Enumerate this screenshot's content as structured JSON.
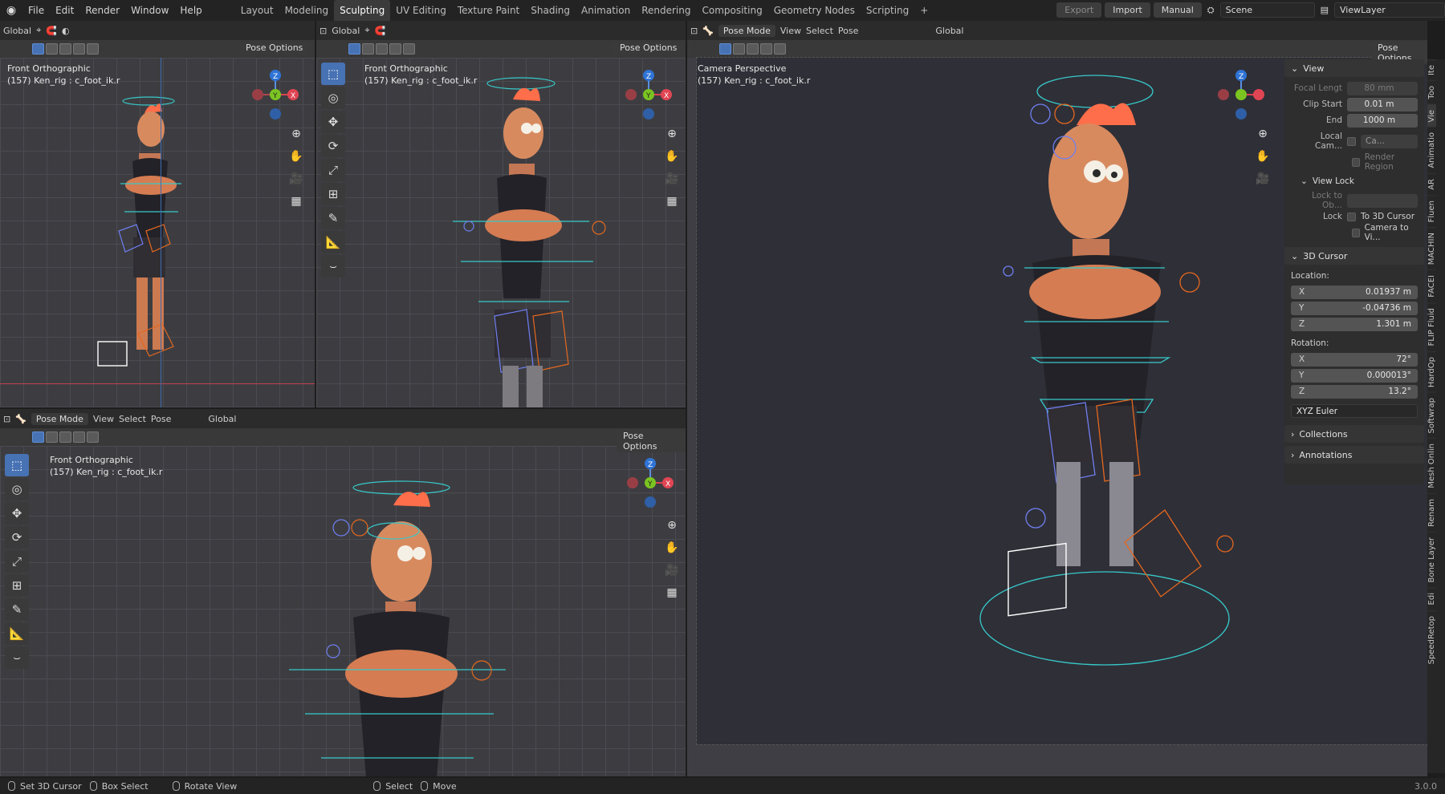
{
  "menu": {
    "items": [
      "File",
      "Edit",
      "Render",
      "Window",
      "Help"
    ]
  },
  "workspaces": {
    "items": [
      "Layout",
      "Modeling",
      "Sculpting",
      "UV Editing",
      "Texture Paint",
      "Shading",
      "Animation",
      "Rendering",
      "Compositing",
      "Geometry Nodes",
      "Scripting"
    ],
    "active": "Sculpting",
    "add": "+"
  },
  "topright": {
    "export": "Export",
    "import": "Import",
    "manual": "Manual",
    "scene": "Scene",
    "view_layer": "ViewLayer"
  },
  "viewport_header": {
    "transform": "Global",
    "mode": "Pose Mode",
    "view": "View",
    "select": "Select",
    "pose": "Pose",
    "pose_options": "Pose Options"
  },
  "viewports": {
    "top_left": {
      "title": "Front Orthographic",
      "info": "(157) Ken_rig : c_foot_ik.r"
    },
    "top_mid": {
      "title": "Front Orthographic",
      "info": "(157) Ken_rig : c_foot_ik.r"
    },
    "bottom": {
      "title": "Front Orthographic",
      "info": "(157) Ken_rig : c_foot_ik.r"
    },
    "camera": {
      "title": "Camera Perspective",
      "info": "(157) Ken_rig : c_foot_ik.r"
    }
  },
  "gizmo": {
    "z": "Z",
    "y": "Y",
    "x": "X"
  },
  "npanel": {
    "view": {
      "header": "View",
      "focal_label": "Focal Lengt",
      "focal_value": "80 mm",
      "clip_start_label": "Clip Start",
      "clip_start_value": "0.01 m",
      "end_label": "End",
      "end_value": "1000 m",
      "local_cam_label": "Local Cam...",
      "local_cam_value": "Ca...",
      "render_region": "Render Region"
    },
    "view_lock": {
      "header": "View Lock",
      "lock_obj_label": "Lock to Ob...",
      "lock_label": "Lock",
      "to_cursor": "To 3D Cursor",
      "camera_to_view": "Camera to Vi..."
    },
    "cursor": {
      "header": "3D Cursor",
      "location_label": "Location:",
      "x": "0.01937 m",
      "y": "-0.04736 m",
      "z": "1.301 m",
      "rotation_label": "Rotation:",
      "rx": "72°",
      "ry": "0.000013°",
      "rz": "13.2°",
      "mode": "XYZ Euler"
    },
    "axis": {
      "x": "X",
      "y": "Y",
      "z": "Z"
    },
    "collections": "Collections",
    "annotations": "Annotations"
  },
  "sidetabs": [
    "Ite",
    "Too",
    "Vie",
    "Animatio",
    "AR",
    "Fluen",
    "MACHIN",
    "FACEI",
    "FLIP Fluid",
    "HardOp",
    "Softwrap",
    "Mesh Onlin",
    "Renam",
    "Bone Layer",
    "Edi",
    "SpeedRetop"
  ],
  "status": {
    "cursor": "Set 3D Cursor",
    "box": "Box Select",
    "rotate": "Rotate View",
    "select": "Select",
    "move": "Move",
    "version": "3.0.0"
  }
}
